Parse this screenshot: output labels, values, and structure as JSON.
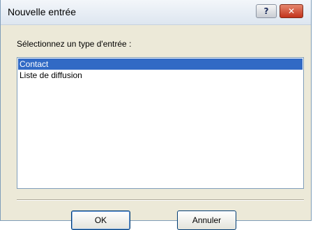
{
  "window": {
    "title": "Nouvelle entrée",
    "help_label": "?",
    "close_label": "✕"
  },
  "prompt": "Sélectionnez un type d'entrée :",
  "entry_types": {
    "items": [
      {
        "label": "Contact",
        "selected": true
      },
      {
        "label": "Liste de diffusion",
        "selected": false
      }
    ]
  },
  "buttons": {
    "ok_label": "OK",
    "cancel_label": "Annuler"
  },
  "colors": {
    "selection": "#316ac5",
    "close_button": "#c2331b",
    "dialog_background": "#ece9d8"
  }
}
